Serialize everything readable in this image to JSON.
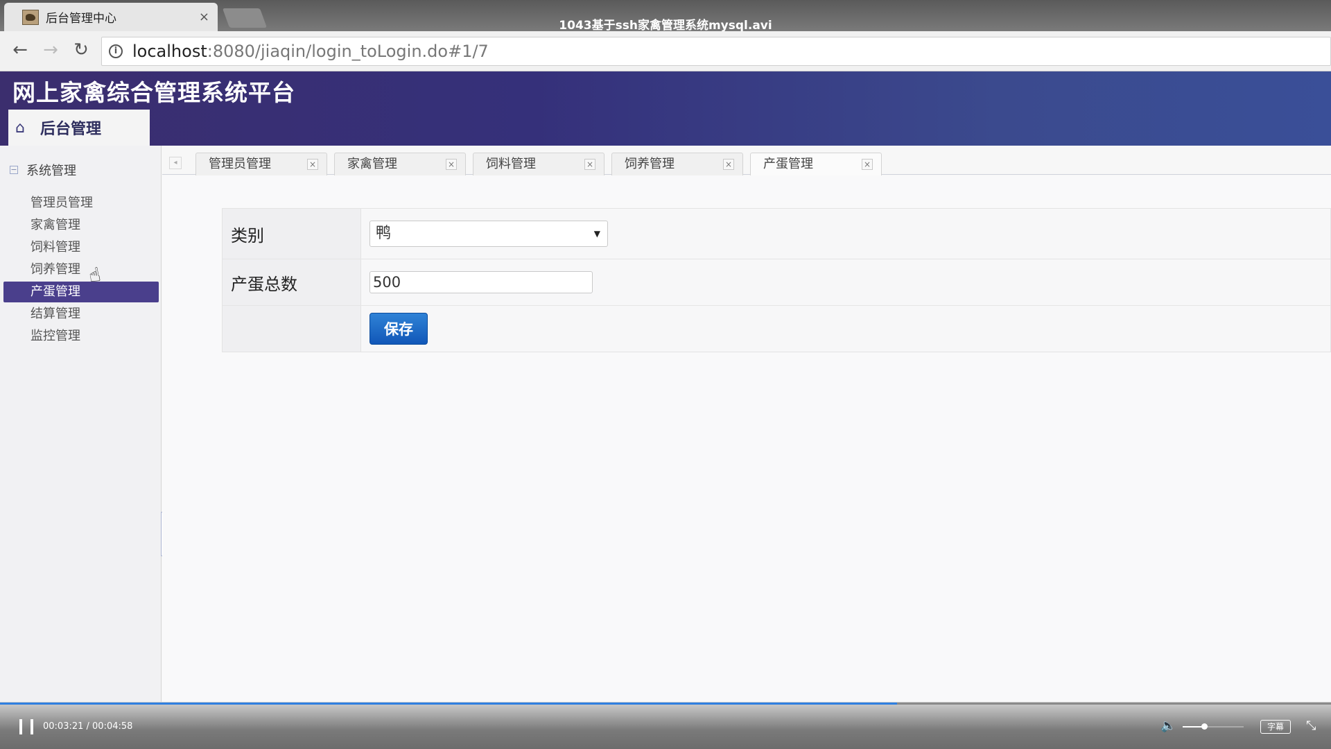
{
  "browser": {
    "tab_title": "后台管理中心",
    "tab_close": "×",
    "video_title": "1043基于ssh家禽管理系统mysql.avi",
    "url_host": "localhost",
    "url_rest": ":8080/jiaqin/login_toLogin.do#1/7",
    "back_icon": "arrow-left",
    "forward_icon": "arrow-right",
    "reload_icon": "reload",
    "info_icon": "info"
  },
  "app": {
    "title": "网上家禽综合管理系统平台",
    "home_tab_label": "后台管理",
    "header_color": "#35307a"
  },
  "sidebar": {
    "group_label": "系统管理",
    "items": [
      {
        "label": "管理员管理",
        "active": false
      },
      {
        "label": "家禽管理",
        "active": false
      },
      {
        "label": "饲料管理",
        "active": false
      },
      {
        "label": "饲养管理",
        "active": false
      },
      {
        "label": "产蛋管理",
        "active": true
      },
      {
        "label": "结算管理",
        "active": false
      },
      {
        "label": "监控管理",
        "active": false
      }
    ],
    "active_color": "#4a3f8c"
  },
  "tabs": [
    {
      "label": "管理员管理",
      "active": false
    },
    {
      "label": "家禽管理",
      "active": false
    },
    {
      "label": "饲料管理",
      "active": false
    },
    {
      "label": "饲养管理",
      "active": false
    },
    {
      "label": "产蛋管理",
      "active": true
    }
  ],
  "form": {
    "category_label": "类别",
    "category_value": "鸭",
    "egg_total_label": "产蛋总数",
    "egg_total_value": "500",
    "save_label": "保存",
    "save_color": "#1f6cc8"
  },
  "player": {
    "time": "00:03:21 / 00:04:58",
    "progress": 0.674,
    "volume": 0.35,
    "subtitle_label": "字幕"
  }
}
